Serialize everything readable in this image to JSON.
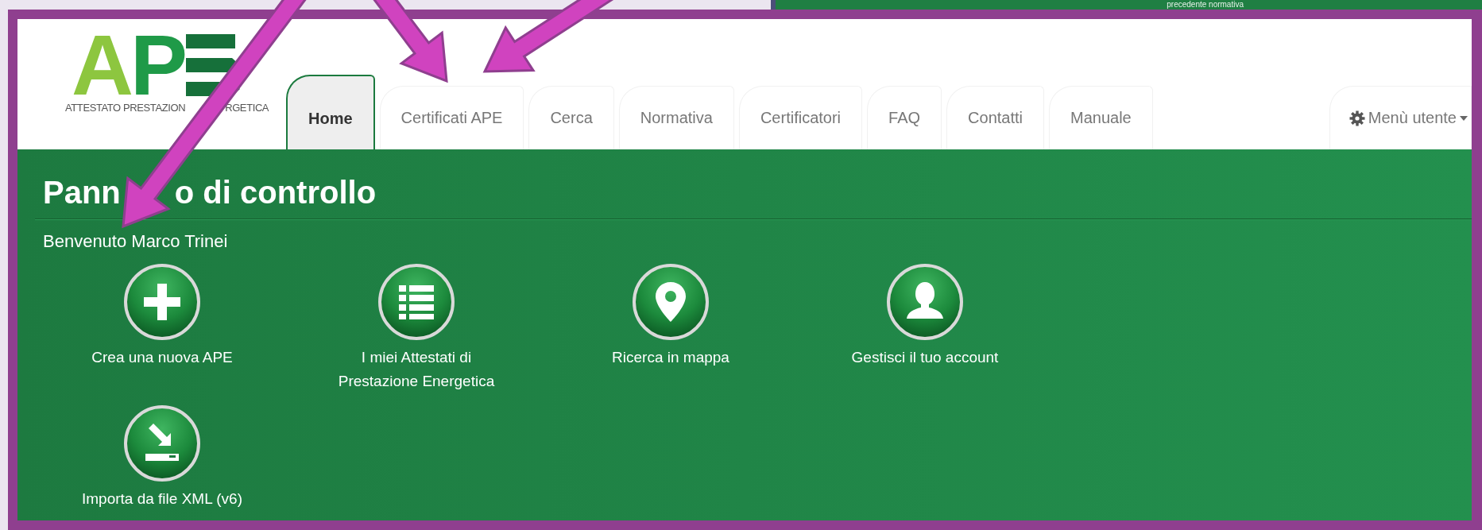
{
  "background_page": {
    "text": "precedente normativa"
  },
  "logo": {
    "mark": "AP",
    "subtitle_parts": [
      "ATTESTATO PRESTAZION",
      "RGETICA"
    ]
  },
  "tabs": [
    {
      "label": "Home",
      "selected": true
    },
    {
      "label": "Certificati APE",
      "selected": false
    },
    {
      "label": "Cerca",
      "selected": false
    },
    {
      "label": "Normativa",
      "selected": false
    },
    {
      "label": "Certificatori",
      "selected": false
    },
    {
      "label": "FAQ",
      "selected": false
    },
    {
      "label": "Contatti",
      "selected": false
    },
    {
      "label": "Manuale",
      "selected": false
    }
  ],
  "user_menu": {
    "label": "Menù utente"
  },
  "panel": {
    "title_parts": [
      "Pann",
      "o di controllo"
    ],
    "welcome": "Benvenuto Marco Trinei",
    "actions": [
      {
        "label": "Crea una nuova APE",
        "kind": "plus"
      },
      {
        "label": "I miei Attestati di Prestazione Energetica",
        "kind": "list"
      },
      {
        "label": "Ricerca in mappa",
        "kind": "pin"
      },
      {
        "label": "Gestisci il tuo account",
        "kind": "user"
      },
      {
        "label": "Importa da file XML (v6)",
        "kind": "import"
      }
    ]
  }
}
